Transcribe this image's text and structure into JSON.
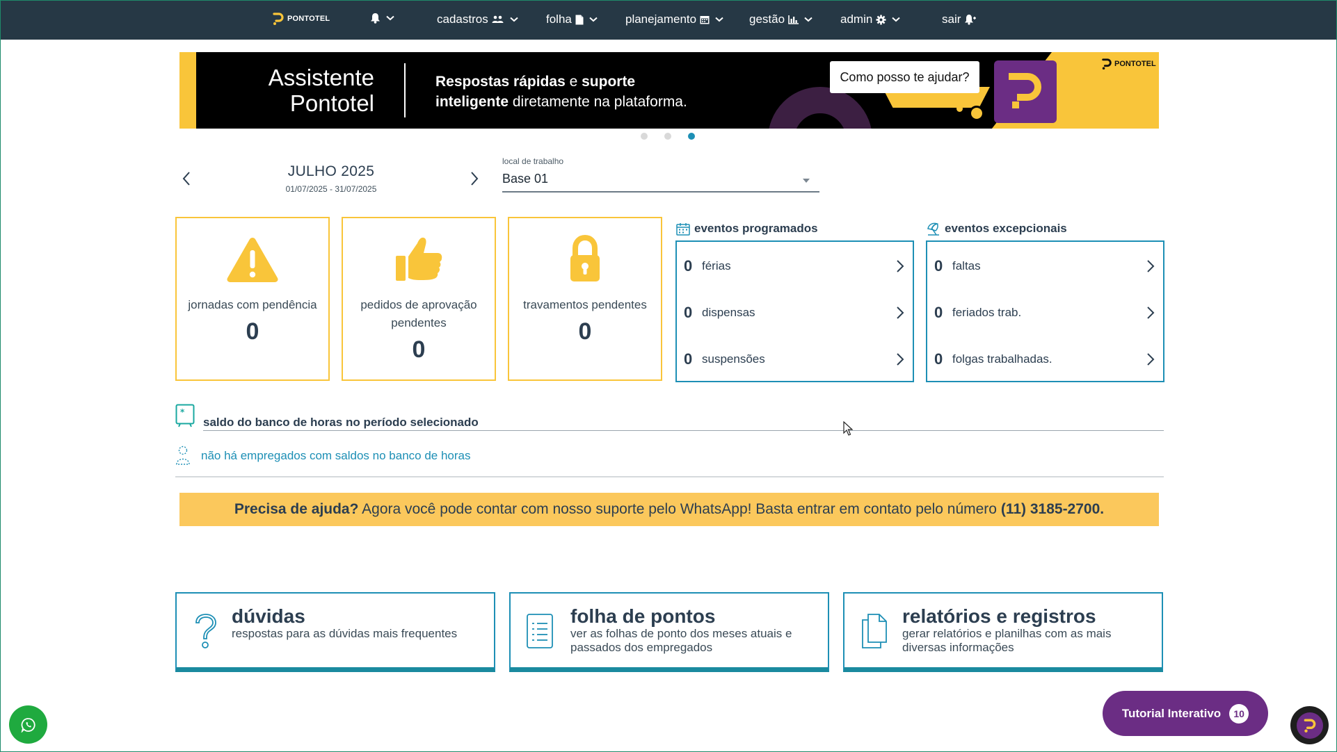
{
  "brand": "PONTOTEL",
  "nav": {
    "notifications_icon": "bell-icon",
    "items": [
      {
        "label": "cadastros",
        "icon": "users-icon"
      },
      {
        "label": "folha",
        "icon": "document-icon"
      },
      {
        "label": "planejamento",
        "icon": "calendar-icon"
      },
      {
        "label": "gestão",
        "icon": "bar-chart-icon"
      },
      {
        "label": "admin",
        "icon": "gear-icon"
      }
    ],
    "logout_label": "sair"
  },
  "banner": {
    "title_line1": "Assistente",
    "title_line2": "Pontotel",
    "text_a": "Respostas rápidas",
    "text_b": " e ",
    "text_c": "suporte",
    "text_d": "inteligente",
    "text_e": " diretamente na plataforma.",
    "chat_bubble": "Como posso te ajudar?",
    "brand": "PONTOTEL"
  },
  "carousel": {
    "total": 3,
    "active_index": 2
  },
  "period": {
    "month": "JULHO 2025",
    "range": "01/07/2025 - 31/07/2025"
  },
  "workplace": {
    "label": "local de trabalho",
    "value": "Base 01"
  },
  "summary_cards": [
    {
      "label": "jornadas com pendência",
      "value": "0",
      "icon": "warning-icon"
    },
    {
      "label": "pedidos de aprovação pendentes",
      "value": "0",
      "icon": "thumbs-up-icon"
    },
    {
      "label": "travamentos pendentes",
      "value": "0",
      "icon": "lock-icon"
    }
  ],
  "scheduled_events": {
    "title": "eventos programados",
    "rows": [
      {
        "count": "0",
        "label": "férias"
      },
      {
        "count": "0",
        "label": "dispensas"
      },
      {
        "count": "0",
        "label": "suspensões"
      }
    ]
  },
  "exceptional_events": {
    "title": "eventos excepcionais",
    "rows": [
      {
        "count": "0",
        "label": "faltas"
      },
      {
        "count": "0",
        "label": "feriados trab."
      },
      {
        "count": "0",
        "label": "folgas trabalhadas."
      }
    ]
  },
  "hour_bank": {
    "title": "saldo do banco de horas no período selecionado",
    "empty_message": "não há empregados com saldos no banco de horas"
  },
  "help_bar": {
    "bold_lead": "Precisa de ajuda?",
    "text": " Agora você pode contar com nosso suporte pelo WhatsApp! Basta entrar em contato pelo número ",
    "phone": "(11) 3185-2700."
  },
  "bottom_cards": [
    {
      "title": "dúvidas",
      "desc": "respostas para as dúvidas mais frequentes",
      "icon": "question-icon"
    },
    {
      "title": "folha de pontos",
      "desc": "ver as folhas de ponto dos meses atuais e passados dos empregados",
      "icon": "list-document-icon"
    },
    {
      "title": "relatórios e registros",
      "desc": "gerar relatórios e planilhas com as mais diversas informações",
      "icon": "files-icon"
    }
  ],
  "tutorial": {
    "label": "Tutorial Interativo",
    "badge": "10"
  },
  "colors": {
    "nav_bg": "#263845",
    "accent_yellow": "#f9c53a",
    "accent_blue": "#1d8fb5",
    "brand_purple": "#6b2d84",
    "whatsapp_green": "#1faa3f"
  }
}
